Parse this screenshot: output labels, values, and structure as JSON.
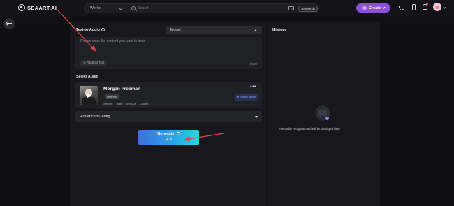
{
  "app": {
    "logo_text": "SEAART.AI"
  },
  "search": {
    "category": "Works",
    "placeholder": "Search",
    "ai_button": "AI search"
  },
  "header": {
    "create_label": "Create",
    "notification_dot_color": "#ff4d6a"
  },
  "tts": {
    "section_title": "Text-to-Audio",
    "model_label": "Model",
    "input_placeholder": "Please enter the content you want to hear.",
    "random_label": "Random Text",
    "char_count": "0/180"
  },
  "select_audio": {
    "title": "Select Audio",
    "voice": {
      "name": "Morgan Freeman",
      "tag": "celebrity",
      "attributes": [
        "Serene",
        "Male",
        "Serious",
        "English"
      ],
      "more": "•••",
      "switch_label": "Switch Audio"
    }
  },
  "advanced": {
    "label": "Advanced Config"
  },
  "generate": {
    "label": "Generate",
    "cost": "⚡ 6",
    "gradient": [
      "#3d6fe0",
      "#27d6d9"
    ]
  },
  "history": {
    "title": "History",
    "empty_text": "The audio you generated will be displayed here"
  },
  "annotations": {
    "arrow_color": "#e0474c"
  }
}
